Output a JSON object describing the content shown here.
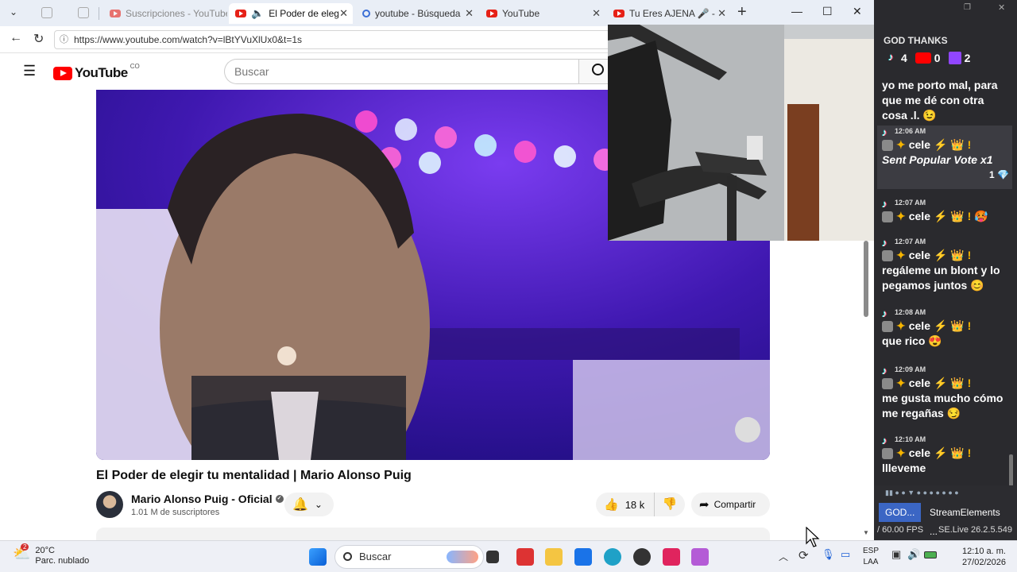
{
  "browser": {
    "tabs": [
      {
        "label": "Suscripciones - YouTube",
        "active": false
      },
      {
        "label": "El Poder de elegir tu",
        "active": true
      },
      {
        "label": "youtube - Búsqueda",
        "active": false
      },
      {
        "label": "YouTube",
        "active": false
      },
      {
        "label": "Tu Eres AJENA 🎤 - Edd",
        "active": false
      }
    ],
    "new_tab": "+",
    "url": "https://www.youtube.com/watch?v=lBtYVuXlUx0&t=1s"
  },
  "youtube": {
    "logo_text": "YouTube",
    "logo_country": "CO",
    "search_placeholder": "Buscar",
    "video_title": "El Poder de elegir tu mentalidad | Mario Alonso Puig",
    "channel_name": "Mario Alonso Puig - Oficial",
    "subscribers": "1.01 M de suscriptores",
    "likes": "18 k",
    "share_label": "Compartir"
  },
  "chat": {
    "title": "GOD THANKS",
    "counts": {
      "tiktok": "4",
      "youtube": "0",
      "twitch": "2"
    },
    "messages": [
      {
        "time": "",
        "user": "",
        "text": "yo me porto mal, para que me dé con otra cosa .l. 😉"
      },
      {
        "time": "12:06 AM",
        "user": "cele",
        "text": "Sent Popular Vote x1",
        "extra": "1 💎"
      },
      {
        "time": "12:07 AM",
        "user": "cele",
        "text": "🥵"
      },
      {
        "time": "12:07 AM",
        "user": "cele",
        "text": "regáleme un blont y lo pegamos juntos 😊"
      },
      {
        "time": "12:08 AM",
        "user": "cele",
        "text": "que rico 😍"
      },
      {
        "time": "12:09 AM",
        "user": "cele",
        "text": "me gusta mucho cómo me regañas 😏"
      },
      {
        "time": "12:10 AM",
        "user": "cele",
        "text": "llleveme"
      }
    ],
    "user_symbols": "⚡ 👑 !",
    "obs_buttons": [
      "GOD...",
      "StreamElements ..."
    ],
    "fps": "/ 60.00 FPS",
    "version": "SE.Live 26.2.5.549"
  },
  "taskbar": {
    "weather_temp": "20°C",
    "weather_desc": "Parc. nublado",
    "weather_badge": "2",
    "search_label": "Buscar",
    "lang_top": "ESP",
    "lang_bottom": "LAA",
    "time": "12:10 a. m.",
    "date": "27/02/2026"
  },
  "colors": {
    "youtube_red": "#ff0000",
    "chat_bg": "#2a2a2e",
    "video_bg": "#3b1aa0",
    "taskbar_bg": "#eef0f6"
  }
}
